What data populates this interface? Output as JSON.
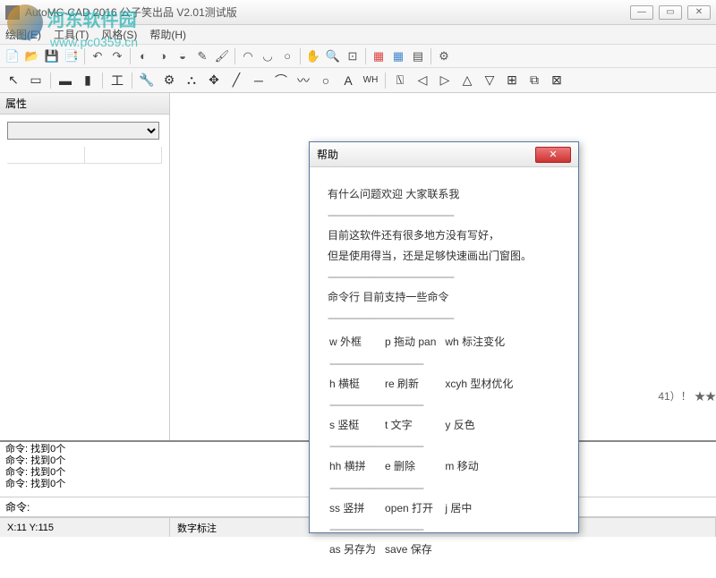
{
  "window": {
    "title": "AutoMC-CAD 2016 公子笑出品   V2.01测试版"
  },
  "watermark": {
    "site_name": "河东软件园",
    "site_url": "www.pc0359.cn"
  },
  "menu": {
    "draw": "绘图(E)",
    "tools": "工具(T)",
    "style": "风格(S)",
    "help": "帮助(H)"
  },
  "sidebar": {
    "properties_title": "属性"
  },
  "canvas": {
    "note_text": "41）！ ★★"
  },
  "cmdlog": {
    "lines": [
      "命令: 找到0个",
      "命令: 找到0个",
      "命令: 找到0个",
      "命令: 找到0个"
    ]
  },
  "cmdline": {
    "label": "命令:"
  },
  "status": {
    "coords": "X:11  Y:115",
    "mode": "数字标注"
  },
  "dialog": {
    "title": "帮助",
    "intro": "有什么问题欢迎  大家联系我",
    "note1": "目前这软件还有很多地方没有写好，",
    "note2": "但是使用得当，还是足够快速画出门窗图。",
    "cmd_title": "命令行 目前支持一些命令",
    "cmds": {
      "r1c1": "w   外框",
      "r1c2": "p   拖动 pan",
      "r1c3": "wh  标注变化",
      "r2c1": "h   横梃",
      "r2c2": "re  刷新",
      "r2c3": "xcyh 型材优化",
      "r3c1": "s   竖梃",
      "r3c2": "t   文字",
      "r3c3": "y 反色",
      "r4c1": "hh  横拼",
      "r4c2": "e   删除",
      "r4c3": "m 移动",
      "r5c1": "ss  竖拼",
      "r5c2": "open 打开",
      "r5c3": "j 居中",
      "r6c1": "as  另存为",
      "r6c2": "save 保存",
      "r6c3": ""
    }
  }
}
